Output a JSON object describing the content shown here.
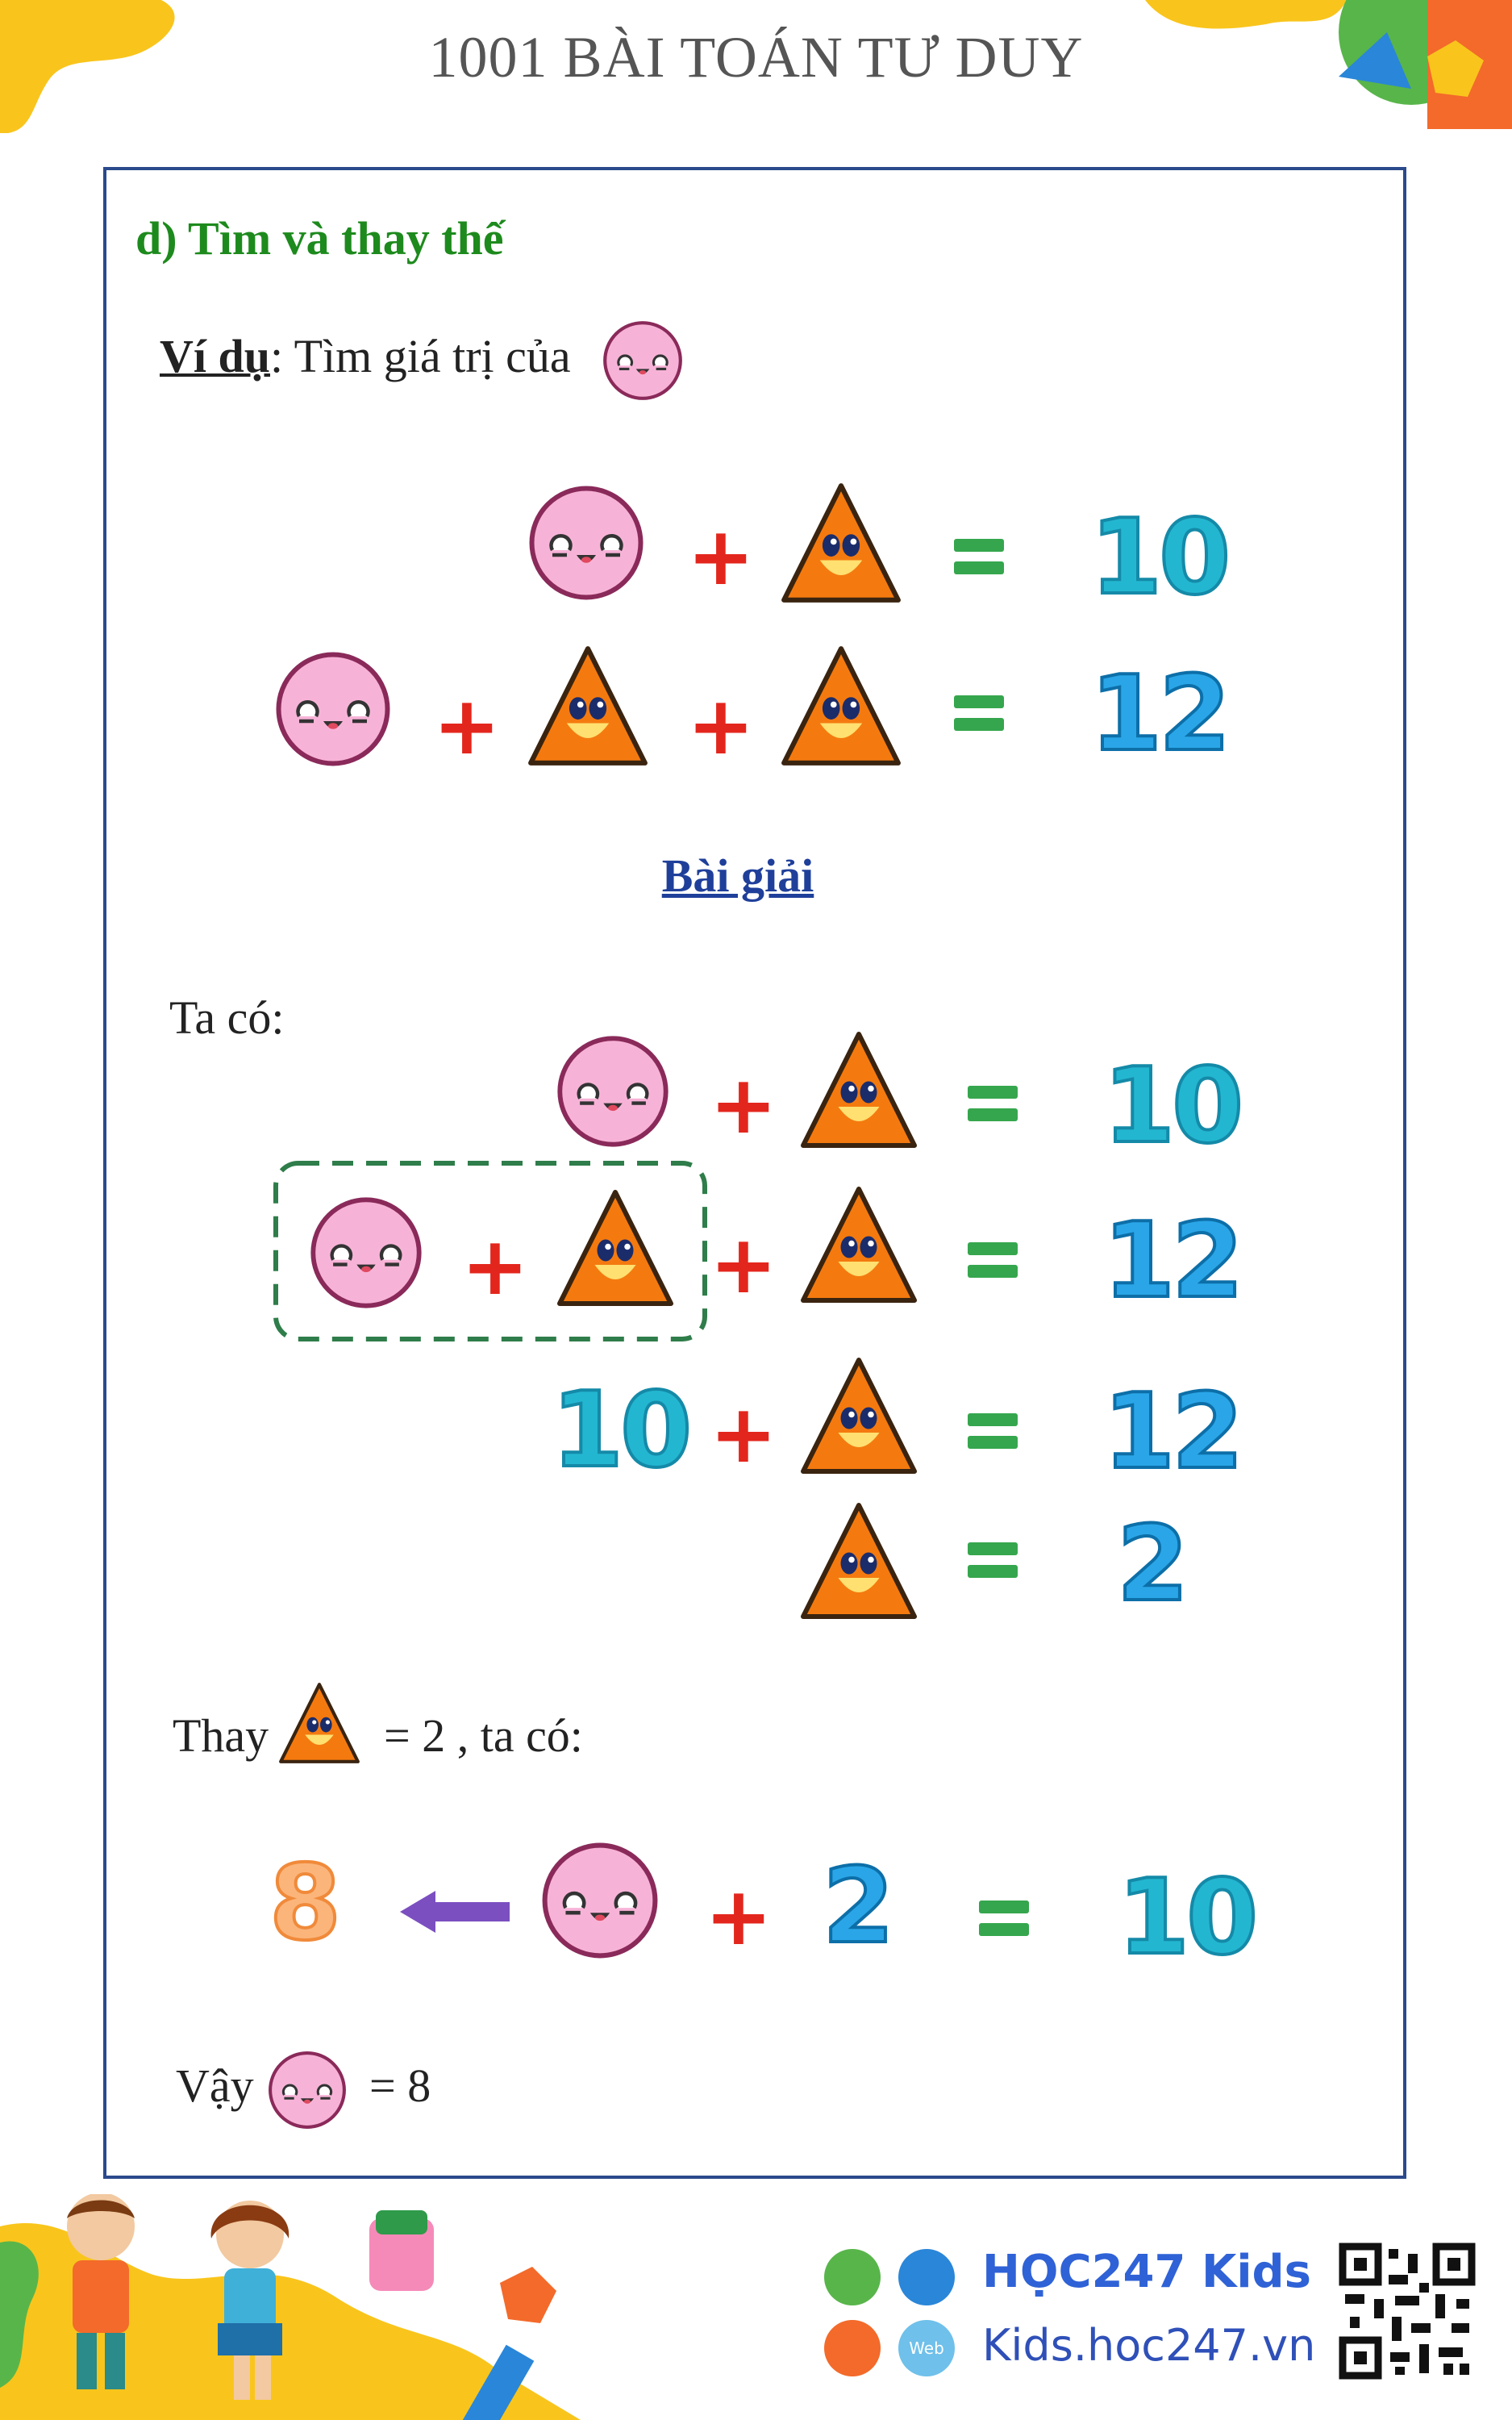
{
  "header": {
    "title": "1001 BÀI TOÁN TƯ DUY"
  },
  "section": {
    "title": "d) Tìm và thay thế",
    "example_label": "Ví dụ",
    "example_text": ": Tìm giá trị của"
  },
  "problem": {
    "eq1_result": "10",
    "eq2_result": "12"
  },
  "solution": {
    "heading": "Bài giải",
    "intro": "Ta có:",
    "row1_result": "10",
    "row2_result": "12",
    "row3_left": "10",
    "row3_result": "12",
    "row4_result": "2",
    "substitute_prefix": "Thay",
    "substitute_suffix": "= 2 , ta có:",
    "final_answer_value": "8",
    "final_b": "2",
    "final_result": "10",
    "conclusion_prefix": "Vậy",
    "conclusion_suffix": "= 8"
  },
  "symbols": {
    "plus": "+"
  },
  "footer": {
    "brand": "HỌC247 Kids",
    "url": "Kids.hoc247.vn",
    "store_label": "Web"
  },
  "colors": {
    "frame": "#2b4a8c",
    "section_title": "#1d8a1d",
    "heading": "#1f3f9a",
    "number_blue": "#2aa6e8",
    "number_orange": "#fbb57b",
    "plus_red": "#e3261d",
    "equals_green": "#35a64d",
    "circle_pink": "#f5b6d8",
    "triangle_orange": "#f47a0f",
    "arrow_purple": "#7b4fc0"
  },
  "icons": [
    "pink-circle-face-icon",
    "orange-triangle-face-icon",
    "left-arrow-icon",
    "apple-android-icon",
    "fox-mascot-icon",
    "monitor-icon",
    "web-icon",
    "qr-code-icon"
  ]
}
